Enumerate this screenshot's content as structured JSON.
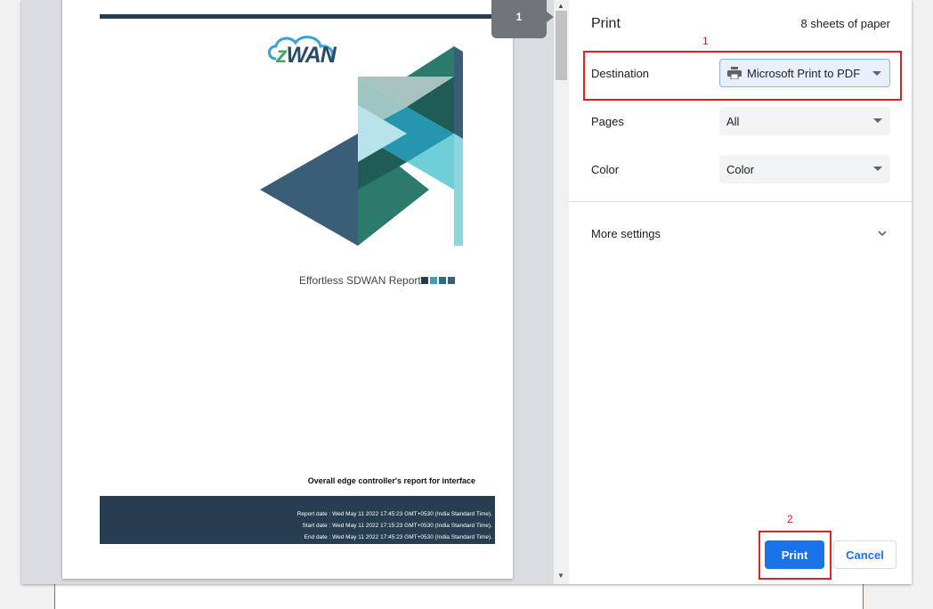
{
  "preview": {
    "page_number": "1",
    "logo_text": "WAN",
    "logo_z": "z",
    "report_title": "Effortless SDWAN Report",
    "overall_title": "Overall edge controller's report for interface",
    "report_date": "Report date : Wed May 11 2022 17:45:23 GMT+0530 (India Standard Time).",
    "start_date": "Start date : Wed May 11 2022 17:15:23 GMT+0530 (India Standard Time).",
    "end_date": "End date : Wed May 11 2022 17:45:23 GMT+0530 (India Standard Time).",
    "square_colors": [
      "#263e4f",
      "#3aa2b2",
      "#2b6e7d",
      "#3b5e78"
    ]
  },
  "settings": {
    "title": "Print",
    "sheets": "8 sheets of paper",
    "destination_label": "Destination",
    "destination_value": "Microsoft Print to PDF",
    "destination_icon": "printer-icon",
    "pages_label": "Pages",
    "pages_value": "All",
    "color_label": "Color",
    "color_value": "Color",
    "more_settings": "More settings"
  },
  "buttons": {
    "print": "Print",
    "cancel": "Cancel"
  },
  "annotations": {
    "label_1": "1",
    "label_2": "2",
    "color": "#e02020"
  },
  "colors": {
    "accent": "#1a73e8",
    "header_bar": "#263e4f"
  }
}
